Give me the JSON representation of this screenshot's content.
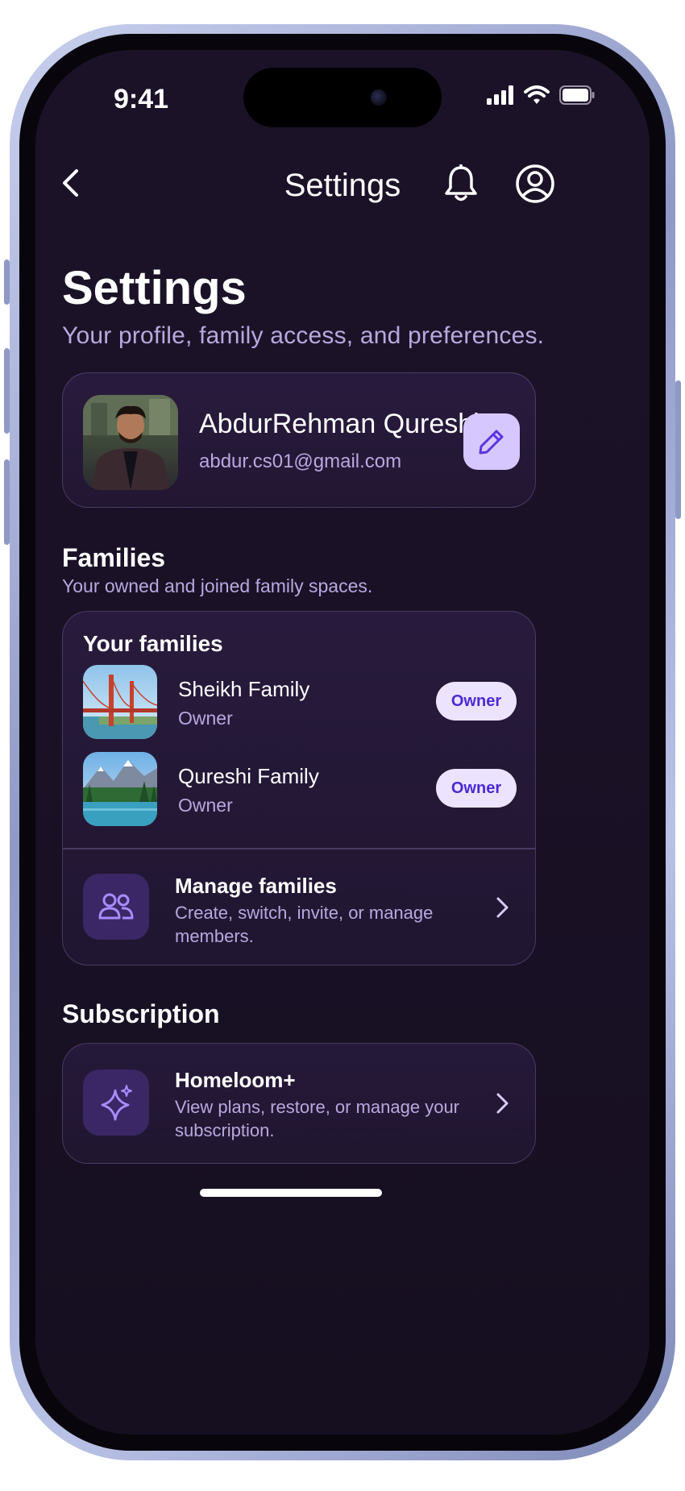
{
  "status_bar": {
    "time": "9:41"
  },
  "nav": {
    "title": "Settings"
  },
  "header": {
    "title": "Settings",
    "subtitle": "Your profile, family access, and preferences."
  },
  "profile": {
    "name": "AbdurRehman Qureshi",
    "email": "abdur.cs01@gmail.com"
  },
  "families_section": {
    "title": "Families",
    "subtitle": "Your owned and joined family spaces.",
    "card_heading": "Your families",
    "families": [
      {
        "name": "Sheikh Family",
        "role": "Owner",
        "badge": "Owner"
      },
      {
        "name": "Qureshi Family",
        "role": "Owner",
        "badge": "Owner"
      }
    ],
    "manage": {
      "title": "Manage families",
      "description": "Create, switch, invite, or manage members."
    }
  },
  "subscription_section": {
    "title": "Subscription",
    "item": {
      "title": "Homeloom+",
      "description": "View plans, restore, or manage your subscription."
    }
  },
  "theme": {
    "background": "#1a1126",
    "accent": "#d6c7ff",
    "accent_text": "#4b2ad6",
    "muted_text": "#b9a8df",
    "icon_tile": "#3b2765"
  }
}
